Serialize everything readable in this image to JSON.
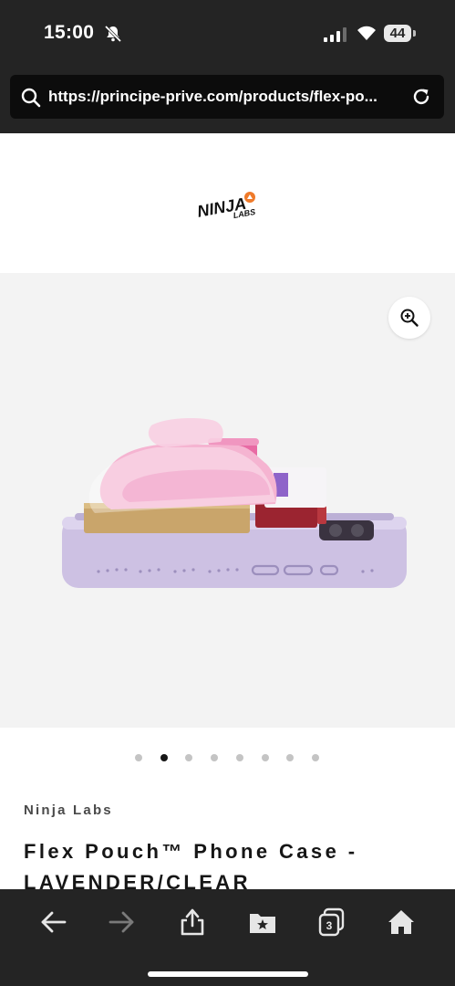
{
  "status_bar": {
    "time": "15:00",
    "battery": "44",
    "icons": [
      "bell-off-icon",
      "signal-icon",
      "wifi-icon",
      "battery-icon"
    ]
  },
  "browser": {
    "url": "https://principe-prive.com/products/flex-po...",
    "icons": [
      "search-icon",
      "reload-icon"
    ]
  },
  "brand": {
    "logo_text": "NINJA",
    "logo_subtext": "LABS",
    "logo_accent": "#ef7a2a"
  },
  "gallery": {
    "slide_count": 8,
    "active_slide": 2,
    "zoom_icon": "zoom-in-icon",
    "background": "#f3f3f3"
  },
  "product": {
    "vendor": "Ninja Labs",
    "title": "Flex Pouch™ Phone Case - LAVENDER/CLEAR"
  },
  "bottom_nav": {
    "icons": [
      "back-icon",
      "forward-icon",
      "share-icon",
      "bookmarks-icon",
      "tabs-icon",
      "home-icon"
    ],
    "tab_count": "3"
  }
}
